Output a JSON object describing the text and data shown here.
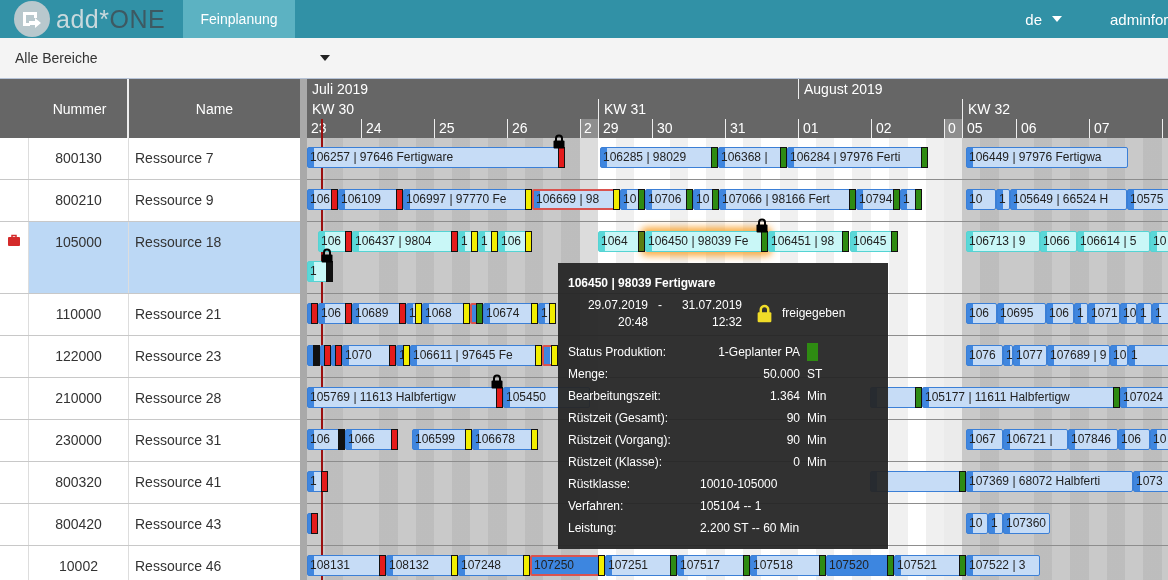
{
  "nav": {
    "brand_light": "add*",
    "brand_dark": "ONE",
    "tabs": [
      {
        "label": "Feinplanung",
        "selected": true
      }
    ],
    "language": "de",
    "user": "adminfor"
  },
  "filter": {
    "value": "Alle Bereiche"
  },
  "table": {
    "columns": [
      "Nummer",
      "Name"
    ]
  },
  "timeline": {
    "months": [
      {
        "label": "Juli 2019"
      },
      {
        "label": "August 2019"
      }
    ],
    "weeks": [
      {
        "label": "KW 30",
        "current": false
      },
      {
        "label": "KW 31",
        "current": true
      },
      {
        "label": "KW 32",
        "current": false
      }
    ],
    "days": [
      {
        "label": "23",
        "kind": "partial"
      },
      {
        "label": "24",
        "kind": "full"
      },
      {
        "label": "25",
        "kind": "full"
      },
      {
        "label": "26",
        "kind": "full"
      },
      {
        "label": "2",
        "kind": "weekend"
      },
      {
        "label": "29",
        "kind": "partial"
      },
      {
        "label": "30",
        "kind": "full"
      },
      {
        "label": "31",
        "kind": "full"
      },
      {
        "label": "01",
        "kind": "full"
      },
      {
        "label": "02",
        "kind": "full"
      },
      {
        "label": "0",
        "kind": "weekend"
      },
      {
        "label": "05",
        "kind": "partial"
      },
      {
        "label": "06",
        "kind": "full"
      },
      {
        "label": "07",
        "kind": "full"
      },
      {
        "kind": "full"
      }
    ]
  },
  "rows": [
    {
      "number": "800130",
      "name": "Ressource 7",
      "selected": false,
      "flagged": false,
      "lanes": [
        [
          {
            "text": "106257 | 97646 Fertigware",
            "kind": "planned",
            "color": "#e41b1b",
            "locked": true,
            "highlighted": false,
            "selected": false
          },
          {
            "text": "106285 | 98029",
            "kind": "planned",
            "color": "#2e8b12",
            "locked": false,
            "highlighted": false,
            "selected": false
          },
          {
            "text": "106368 |",
            "kind": "planned",
            "color": "#2e8b12",
            "locked": false,
            "highlighted": false,
            "selected": false
          },
          {
            "text": "106284 | 97976 Ferti",
            "kind": "planned",
            "color": "#2e8b12",
            "locked": false,
            "highlighted": false,
            "selected": false
          },
          {
            "text": "106449 | 97976 Fertigwa",
            "kind": "planned",
            "locked": false,
            "highlighted": false,
            "selected": false
          }
        ]
      ]
    },
    {
      "number": "800210",
      "name": "Ressource 9",
      "selected": false,
      "flagged": false,
      "lanes": [
        [
          {
            "text": "106",
            "kind": "planned",
            "color": "#e41b1b",
            "locked": false,
            "highlighted": false,
            "selected": false
          },
          {
            "text": "106109",
            "kind": "planned",
            "color": "#e41b1b",
            "locked": false,
            "highlighted": false,
            "selected": false
          },
          {
            "text": "106997 | 97770 Fe",
            "kind": "planned",
            "color": "#f2ee00",
            "locked": false,
            "highlighted": false,
            "selected": false
          },
          {
            "text": "106669 | 98",
            "kind": "planned",
            "color": "#f2ee00",
            "locked": false,
            "highlighted": true,
            "selected": false
          },
          {
            "text": "10",
            "kind": "planned",
            "color": "#2e8b12",
            "locked": false,
            "highlighted": false,
            "selected": false
          },
          {
            "text": "10706",
            "kind": "planned",
            "color": "#2e8b12",
            "locked": false,
            "highlighted": false,
            "selected": false
          },
          {
            "text": "10",
            "kind": "planned",
            "color": "#2e8b12",
            "locked": false,
            "highlighted": false,
            "selected": false
          },
          {
            "text": "107066 | 98166 Fert",
            "kind": "planned",
            "color": "#2e8b12",
            "locked": false,
            "highlighted": false,
            "selected": false
          },
          {
            "text": "10794",
            "kind": "planned",
            "color": "#2e8b12",
            "locked": false,
            "highlighted": false,
            "selected": false
          },
          {
            "text": "1",
            "kind": "planned",
            "color": "#2e8b12",
            "locked": false,
            "highlighted": false,
            "selected": false
          },
          {
            "text": "10",
            "kind": "planned",
            "locked": false,
            "highlighted": false,
            "selected": false
          },
          {
            "text": "1",
            "kind": "planned",
            "locked": false,
            "highlighted": false,
            "selected": false
          },
          {
            "text": "105649 | 66524 H",
            "kind": "planned",
            "locked": false,
            "highlighted": false,
            "selected": false
          },
          {
            "text": "10575",
            "kind": "planned",
            "locked": false,
            "highlighted": false,
            "selected": false
          }
        ]
      ]
    },
    {
      "number": "105000",
      "name": "Ressource 18",
      "selected": true,
      "flagged": true,
      "lanes": [
        [
          {
            "text": "106",
            "kind": "released",
            "color": "#e41b1b",
            "locked": false,
            "highlighted": false,
            "selected": false
          },
          {
            "text": "106437 | 9804",
            "kind": "released",
            "color": "#e41b1b",
            "locked": false,
            "highlighted": false,
            "selected": false
          },
          {
            "text": "1",
            "kind": "released",
            "color": "#f2ee00",
            "locked": false,
            "highlighted": false,
            "selected": false
          },
          {
            "text": "1",
            "kind": "released",
            "color": "#f2ee00",
            "locked": false,
            "highlighted": false,
            "selected": false
          },
          {
            "text": "106",
            "kind": "released",
            "color": "#f2ee00",
            "locked": false,
            "highlighted": false,
            "selected": false
          },
          {
            "text": "1064",
            "kind": "released",
            "color": "#5a7d10",
            "locked": false,
            "highlighted": false,
            "selected": false
          },
          {
            "text": "106450 | 98039 Fe",
            "kind": "released",
            "color": "#2e8b12",
            "locked": true,
            "highlighted": false,
            "selected": true
          },
          {
            "text": "106451 | 98",
            "kind": "released",
            "color": "#2e8b12",
            "locked": false,
            "highlighted": false,
            "selected": false
          },
          {
            "text": "10645",
            "kind": "released",
            "color": "#2e8b12",
            "locked": false,
            "highlighted": false,
            "selected": false
          },
          {
            "text": "106713 | 9",
            "kind": "released",
            "locked": false,
            "highlighted": false,
            "selected": false
          },
          {
            "text": "1066",
            "kind": "released",
            "locked": false,
            "highlighted": false,
            "selected": false
          },
          {
            "text": "106614 | 5",
            "kind": "released",
            "locked": false,
            "highlighted": false,
            "selected": false
          },
          {
            "text": "10",
            "kind": "released",
            "locked": false,
            "highlighted": false,
            "selected": false
          }
        ],
        [
          {
            "text": "1",
            "kind": "released",
            "color": "#111111",
            "locked": true,
            "highlighted": false,
            "selected": false
          }
        ]
      ]
    },
    {
      "number": "110000",
      "name": "Ressource 21",
      "selected": false,
      "flagged": false,
      "lanes": [
        [
          {
            "kind": "planned",
            "color": "#e41b1b",
            "locked": false,
            "highlighted": false,
            "selected": false
          },
          {
            "text": "106",
            "kind": "planned",
            "color": "#e41b1b",
            "locked": false,
            "highlighted": false,
            "selected": false
          },
          {
            "text": "10689",
            "kind": "planned",
            "color": "#e41b1b",
            "locked": false,
            "highlighted": false,
            "selected": false
          },
          {
            "text": "1",
            "kind": "planned",
            "color": "#f2ee00",
            "locked": false,
            "highlighted": false,
            "selected": false
          },
          {
            "text": "1068",
            "kind": "planned",
            "color": "#f2ee00",
            "locked": false,
            "highlighted": false,
            "selected": false
          },
          {
            "kind": "planned",
            "color": "#2e8b12",
            "locked": false,
            "highlighted": true,
            "selected": false
          },
          {
            "text": "10674",
            "kind": "planned",
            "color": "#f2ee00",
            "locked": false,
            "highlighted": false,
            "selected": false
          },
          {
            "text": "1",
            "kind": "planned",
            "color": "#f2ee00",
            "locked": false,
            "highlighted": false,
            "selected": false
          },
          {
            "text": "106",
            "kind": "planned",
            "locked": false,
            "highlighted": false,
            "selected": false
          },
          {
            "text": "10695",
            "kind": "planned",
            "locked": false,
            "highlighted": false,
            "selected": false
          },
          {
            "text": "106",
            "kind": "planned",
            "locked": false,
            "highlighted": false,
            "selected": false
          },
          {
            "text": "1",
            "kind": "planned",
            "locked": false,
            "highlighted": false,
            "selected": false
          },
          {
            "text": "1071",
            "kind": "planned",
            "locked": false,
            "highlighted": false,
            "selected": false
          },
          {
            "text": "10",
            "kind": "planned",
            "locked": false,
            "highlighted": false,
            "selected": false
          },
          {
            "text": "1",
            "kind": "planned",
            "locked": false,
            "highlighted": false,
            "selected": false
          },
          {
            "text": "1",
            "kind": "planned",
            "locked": false,
            "highlighted": false,
            "selected": false
          }
        ]
      ]
    },
    {
      "number": "122000",
      "name": "Ressource 23",
      "selected": false,
      "flagged": false,
      "lanes": [
        [
          {
            "kind": "planned",
            "color": "#111111",
            "locked": false,
            "highlighted": false,
            "selected": false
          },
          {
            "kind": "planned",
            "color": "#e41b1b",
            "locked": false,
            "highlighted": false,
            "selected": false
          },
          {
            "kind": "planned",
            "color": "#e41b1b",
            "locked": false,
            "highlighted": false,
            "selected": false
          },
          {
            "text": "1070",
            "kind": "planned",
            "color": "#e41b1b",
            "locked": false,
            "highlighted": false,
            "selected": false
          },
          {
            "text": "1",
            "kind": "planned",
            "color": "#f2ee00",
            "locked": false,
            "highlighted": false,
            "selected": false
          },
          {
            "text": "106611 | 97645 Fe",
            "kind": "planned",
            "color": "#f2ee00",
            "locked": false,
            "highlighted": false,
            "selected": false
          },
          {
            "kind": "planned",
            "color": "#f2ee00",
            "locked": false,
            "highlighted": true,
            "selected": false
          },
          {
            "text": "1076",
            "kind": "planned",
            "locked": false,
            "highlighted": false,
            "selected": false
          },
          {
            "text": "1",
            "kind": "planned",
            "locked": false,
            "highlighted": false,
            "selected": false
          },
          {
            "text": "1077",
            "kind": "planned",
            "locked": false,
            "highlighted": false,
            "selected": false
          },
          {
            "text": "107689 | 9",
            "kind": "planned",
            "locked": false,
            "highlighted": false,
            "selected": false
          },
          {
            "text": "10",
            "kind": "planned",
            "locked": false,
            "highlighted": false,
            "selected": false
          },
          {
            "text": "1",
            "kind": "planned",
            "locked": false,
            "highlighted": false,
            "selected": false
          }
        ]
      ]
    },
    {
      "number": "210000",
      "name": "Ressource 28",
      "selected": false,
      "flagged": false,
      "lanes": [
        [
          {
            "text": "105769 | 11613 Halbfertigw",
            "kind": "planned",
            "color": "#e41b1b",
            "locked": true,
            "highlighted": false,
            "selected": false
          },
          {
            "text": "105450",
            "kind": "planned",
            "locked": false,
            "highlighted": false,
            "selected": false
          },
          {
            "kind": "planned",
            "color": "#2e8b12",
            "locked": false,
            "highlighted": false,
            "selected": false
          },
          {
            "text": "105177 | 11611 Halbfertigw",
            "kind": "planned",
            "color": "#2e8b12",
            "locked": false,
            "highlighted": false,
            "selected": false
          },
          {
            "text": "107024",
            "kind": "planned",
            "locked": false,
            "highlighted": false,
            "selected": false
          }
        ]
      ]
    },
    {
      "number": "230000",
      "name": "Ressource 31",
      "selected": false,
      "flagged": false,
      "lanes": [
        [
          {
            "text": "106",
            "kind": "planned",
            "color": "#111111",
            "locked": false,
            "highlighted": false,
            "selected": false
          },
          {
            "text": "1066",
            "kind": "planned",
            "color": "#e41b1b",
            "locked": false,
            "highlighted": false,
            "selected": false
          },
          {
            "text": "106599",
            "kind": "planned",
            "color": "#f2ee00",
            "locked": false,
            "highlighted": false,
            "selected": false
          },
          {
            "text": "106678",
            "kind": "planned",
            "color": "#f2ee00",
            "locked": false,
            "highlighted": false,
            "selected": false
          },
          {
            "text": "1067",
            "kind": "planned",
            "locked": false,
            "highlighted": false,
            "selected": false
          },
          {
            "text": "106721 |",
            "kind": "planned",
            "locked": false,
            "highlighted": false,
            "selected": false
          },
          {
            "text": "107846",
            "kind": "planned",
            "locked": false,
            "highlighted": false,
            "selected": false
          },
          {
            "text": "106",
            "kind": "planned",
            "locked": false,
            "highlighted": false,
            "selected": false
          },
          {
            "text": "10",
            "kind": "planned",
            "locked": false,
            "highlighted": false,
            "selected": false
          }
        ]
      ]
    },
    {
      "number": "800320",
      "name": "Ressource 41",
      "selected": false,
      "flagged": false,
      "lanes": [
        [
          {
            "text": "1",
            "kind": "planned",
            "color": "#e41b1b",
            "locked": false,
            "highlighted": false,
            "selected": false
          },
          {
            "kind": "planned",
            "color": "#2e8b12",
            "locked": false,
            "highlighted": false,
            "selected": false
          },
          {
            "text": "107369 | 68072 Halbferti",
            "kind": "planned",
            "locked": false,
            "highlighted": false,
            "selected": false
          },
          {
            "text": "1073",
            "kind": "planned",
            "locked": false,
            "highlighted": false,
            "selected": false
          }
        ]
      ]
    },
    {
      "number": "800420",
      "name": "Ressource 43",
      "selected": false,
      "flagged": false,
      "lanes": [
        [
          {
            "kind": "planned",
            "color": "#e41b1b",
            "locked": false,
            "highlighted": false,
            "selected": false
          },
          {
            "text": "10",
            "kind": "planned",
            "locked": false,
            "highlighted": false,
            "selected": false
          },
          {
            "text": "1",
            "kind": "planned",
            "locked": false,
            "highlighted": false,
            "selected": false
          },
          {
            "text": "107360",
            "kind": "planned",
            "locked": false,
            "highlighted": false,
            "selected": false
          }
        ]
      ]
    },
    {
      "number": "10002",
      "name": "Ressource 46",
      "selected": false,
      "flagged": false,
      "lanes": [
        [
          {
            "text": "108131",
            "kind": "planned",
            "color": "#e41b1b",
            "locked": false,
            "highlighted": false,
            "selected": false
          },
          {
            "text": "108132",
            "kind": "planned",
            "color": "#f2ee00",
            "locked": false,
            "highlighted": false,
            "selected": false
          },
          {
            "text": "107248",
            "kind": "planned",
            "color": "#f2ee00",
            "locked": false,
            "highlighted": false,
            "selected": false
          },
          {
            "text": "107250",
            "kind": "active",
            "color": "#f2ee00",
            "locked": false,
            "highlighted": true,
            "selected": false
          },
          {
            "text": "107251",
            "kind": "planned",
            "color": "#2e8b12",
            "locked": false,
            "highlighted": false,
            "selected": false
          },
          {
            "text": "107517",
            "kind": "planned",
            "color": "#2e8b12",
            "locked": false,
            "highlighted": false,
            "selected": false
          },
          {
            "text": "107518",
            "kind": "planned",
            "color": "#2e8b12",
            "locked": false,
            "highlighted": false,
            "selected": false
          },
          {
            "text": "107520",
            "kind": "active",
            "color": "#2e8b12",
            "locked": false,
            "highlighted": false,
            "selected": false
          },
          {
            "text": "107521",
            "kind": "planned",
            "color": "#2e8b12",
            "locked": false,
            "highlighted": false,
            "selected": false
          },
          {
            "text": "107522 | 3",
            "kind": "planned",
            "locked": false,
            "highlighted": false,
            "selected": false
          }
        ]
      ]
    }
  ],
  "tooltip": {
    "title": "106450 | 98039 Fertigware",
    "start_date": "29.07.2019",
    "separator": "-",
    "end_date": "31.07.2019",
    "start_time": "20:48",
    "end_time": "12:32",
    "release_status": "freigegeben",
    "fields": [
      {
        "kind": "status",
        "label": "Status Produktion:",
        "value": "1-Geplanter PA",
        "color": "#2e8b12"
      },
      {
        "kind": "number",
        "label": "Menge:",
        "value": "50.000",
        "unit": "ST"
      },
      {
        "kind": "number",
        "label": "Bearbeitungszeit:",
        "value": "1.364",
        "unit": "Min"
      },
      {
        "kind": "number",
        "label": "Rüstzeit (Gesamt):",
        "value": "90",
        "unit": "Min"
      },
      {
        "kind": "number",
        "label": "Rüstzeit (Vorgang):",
        "value": "90",
        "unit": "Min"
      },
      {
        "kind": "number",
        "label": "Rüstzeit (Klasse):",
        "value": "0",
        "unit": "Min"
      },
      {
        "kind": "text",
        "label": "Rüstklasse:",
        "value": "10010-105000"
      },
      {
        "kind": "text",
        "label": "Verfahren:",
        "value": "105104 -- 1"
      },
      {
        "kind": "text",
        "label": "Leistung:",
        "value": "2.200 ST -- 60 Min"
      }
    ]
  }
}
